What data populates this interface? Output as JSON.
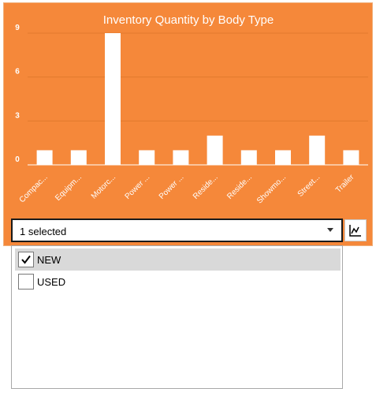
{
  "chart_data": {
    "type": "bar",
    "title": "Inventory Quantity by Body Type",
    "categories": [
      "Compac...",
      "Equipm...",
      "Motorc...",
      "Power ...",
      "Power ...",
      "Reside...",
      "Reside...",
      "Showmo...",
      "Street...",
      "Trailer"
    ],
    "values": [
      1,
      1,
      9,
      1,
      1,
      2,
      1,
      1,
      2,
      1
    ],
    "yticks": [
      "0",
      "3",
      "6",
      "9"
    ],
    "ylim": [
      0,
      9
    ],
    "grid": true,
    "bar_color": "#ffffff",
    "background": "#f5883a"
  },
  "filter": {
    "selected_text": "1 selected",
    "options": [
      {
        "label": "NEW",
        "checked": true
      },
      {
        "label": "USED",
        "checked": false
      }
    ]
  },
  "icons": {
    "dropdown": "chevron-down-icon",
    "chart_button": "line-chart-icon",
    "check": "checkmark-icon"
  }
}
